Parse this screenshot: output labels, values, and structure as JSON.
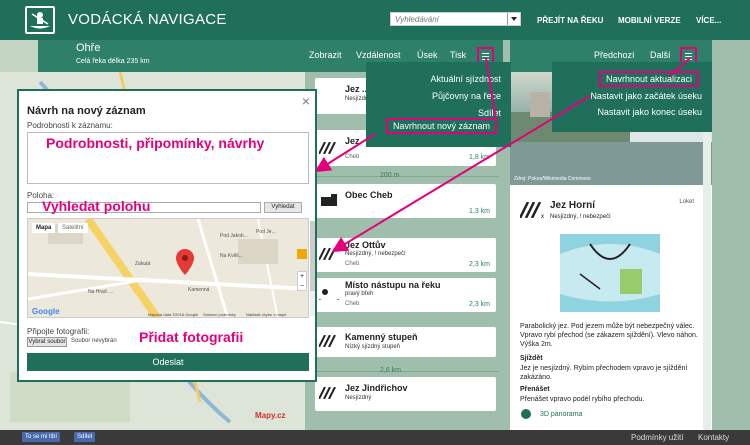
{
  "app": {
    "title": "VODÁCKÁ NAVIGACE"
  },
  "search": {
    "placeholder": "Vyhledávání"
  },
  "topnav": [
    "PŘEJÍT NA ŘEKU",
    "MOBILNÍ VERZE",
    "VÍCE..."
  ],
  "river": {
    "name": "Ohře",
    "length": "Celá řeka délka 235 km"
  },
  "list_toolbar": [
    "Zobrazit",
    "Vzdálenost",
    "Úsek",
    "Tisk"
  ],
  "detail_toolbar": [
    "Předchozí",
    "Další"
  ],
  "list_menu": [
    "Aktuální sjízdnost",
    "Půjčovny na řece",
    "Sdílet",
    "Navrhnout nový záznam"
  ],
  "detail_menu": [
    "Navrhnout aktualizaci",
    "Nastavit jako začátek úseku",
    "Nastavit jako konec úseku"
  ],
  "list": {
    "items": [
      {
        "name": "Jez ...",
        "sub": "Nesjízdný, ...",
        "side": "",
        "km": ""
      },
      {
        "name": "Jez",
        "sub": "",
        "side": "Cheb",
        "km": "1,8 km"
      },
      {
        "name": "Obec Cheb",
        "sub": "",
        "side": "",
        "km": "1,3 km"
      },
      {
        "name": "Jez Ottův",
        "sub": "Nesjízdný, ! nebezpečí",
        "side": "Cheb",
        "km": "2,3 km"
      },
      {
        "name": "Místo nástupu na řeku",
        "sub": "pravý břeh",
        "side": "Cheb",
        "km": "2,3 km"
      },
      {
        "name": "Kamenný stupeň",
        "sub": "Nízký sjízdný stupeň",
        "side": "",
        "km": ""
      },
      {
        "name": "Jez Jindřichov",
        "sub": "Nesjízdný",
        "side": "",
        "km": ""
      }
    ],
    "gaps": [
      "200 m",
      "2,6 km"
    ]
  },
  "detail": {
    "photo_credit": "Zdroj: Pokos/Wikimedia Commons",
    "title": "Jez Horní",
    "subtitle": "Nesjízdný, ! nebezpečí",
    "location": "Loket",
    "description": "Parabolický jez. Pod jezem může být nebezpečný válec. Vpravo rybí přechod (se zákazem sjíždění). Vlevo náhon. Výška 2m.",
    "sjizdet_head": "Sjíždět",
    "sjizdet_text": "Jez je nesjízdný. Rybím přechodem vpravo je sjíždění zakázáno.",
    "prenaset_head": "Přenášet",
    "prenaset_text": "Přenášet vpravo podél rybího přechodu.",
    "panorama": "3D panorama"
  },
  "modal": {
    "title": "Návrh na nový záznam",
    "details_label": "Podrobnosti k záznamu:",
    "details_overlay": "Podrobnosti, připomínky, návrhy",
    "location_label": "Poloha:",
    "location_overlay": "Vyhledat polohu",
    "location_button": "Vyhledat",
    "map_tabs": [
      "Mapa",
      "Satelitní"
    ],
    "map_streets": [
      "Zakutá",
      "Pod Jakob...",
      "Na Kvěli...",
      "Kamenná",
      "Pod Je...",
      "Na Hrad. ..."
    ],
    "map_copyright": "Mapová data ©2016 Google",
    "map_links": [
      "Smluvní podmínky",
      "Nahlásit chybu v mapě"
    ],
    "google": "Google",
    "photos_label": "Připojte fotografii:",
    "file_button": "Vybrat soubor",
    "file_text": "Soubor nevybrán",
    "photos_overlay": "Přidat fotografii",
    "submit": "Odeslat"
  },
  "mapy": "Mapy.cz",
  "footer": {
    "like": "To se mi líbí",
    "share": "Sdílet",
    "terms": "Podmínky užití",
    "contacts": "Kontakty"
  },
  "colors": {
    "brand": "#1f6f5b",
    "highlight": "#e4007c",
    "warning": "#e8a400"
  }
}
